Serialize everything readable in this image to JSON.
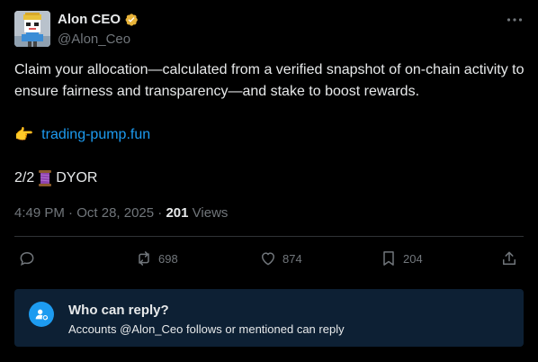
{
  "author": {
    "name": "Alon CEO",
    "handle": "@Alon_Ceo",
    "verified_badge_color": "#e8b339",
    "avatar_icon": "robot-character-avatar"
  },
  "more_icon": "more-dots-icon",
  "tweet": {
    "text": "Claim your allocation—calculated from a verified snapshot of on-chain activity to ensure fairness and transparency—and stake to boost rewards.",
    "link_emoji": "👉",
    "link_text": "trading-pump.fun",
    "thread_counter": "2/2",
    "thread_emoji_icon": "thread-spool-icon",
    "thread_suffix": "DYOR"
  },
  "meta": {
    "time": "4:49 PM",
    "separator1": "·",
    "date": "Oct 28, 2025",
    "separator2": "·",
    "views_count": "201",
    "views_label": "Views"
  },
  "actions": {
    "reply": {
      "icon": "reply-bubble-icon",
      "count": ""
    },
    "repost": {
      "icon": "repost-icon",
      "count": "698"
    },
    "like": {
      "icon": "heart-icon",
      "count": "874"
    },
    "bookmark": {
      "icon": "bookmark-icon",
      "count": "204"
    },
    "share": {
      "icon": "share-upload-icon",
      "count": ""
    }
  },
  "reply_restriction": {
    "title": "Who can reply?",
    "description": "Accounts @Alon_Ceo follows or mentioned can reply",
    "icon": "mention-user-icon"
  },
  "colors": {
    "background": "#000000",
    "text_primary": "#e7e9ea",
    "text_secondary": "#71767b",
    "link": "#1d9bf0",
    "reply_box": "#0d2034",
    "divider": "#2f3336"
  }
}
